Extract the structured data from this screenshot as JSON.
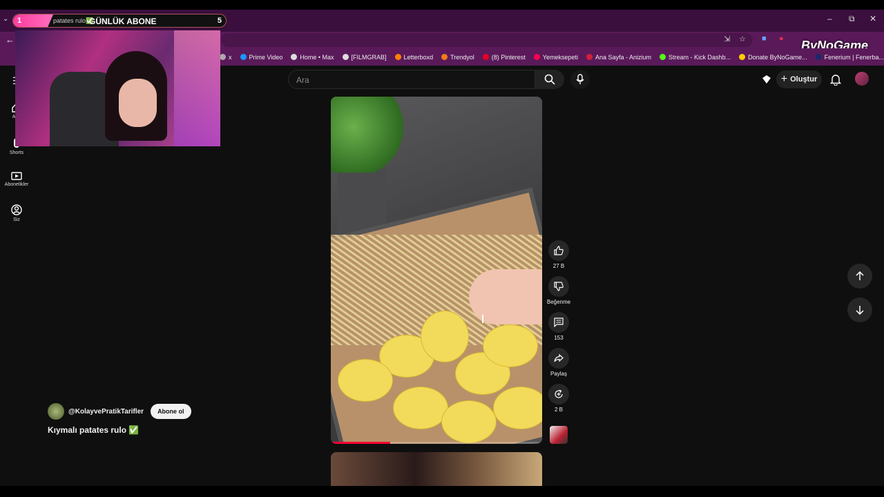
{
  "stream_overlay": {
    "left_number": "1",
    "small_text": "patates rulo✅",
    "title": "GÜNLÜK ABONE",
    "right_number": "5"
  },
  "window_controls": {
    "minimize": "–",
    "restore": "⧉",
    "close": "✕"
  },
  "bookmarks": [
    {
      "label": "x",
      "color": "#aaaaaa"
    },
    {
      "label": "Prime Video",
      "color": "#1a98ff"
    },
    {
      "label": "Home • Max",
      "color": "#dddddd"
    },
    {
      "label": "[FILMGRAB]",
      "color": "#dddddd"
    },
    {
      "label": "Letterboxd",
      "color": "#ff8000"
    },
    {
      "label": "Trendyol",
      "color": "#f27a1a"
    },
    {
      "label": "(8) Pinterest",
      "color": "#e60023"
    },
    {
      "label": "Yemeksepeti",
      "color": "#fa0050"
    },
    {
      "label": "Ana Sayfa - Anizium",
      "color": "#d0203a"
    },
    {
      "label": "Stream - Kick Dashb...",
      "color": "#53fc18"
    },
    {
      "label": "Donate ByNoGame...",
      "color": "#ffcc00"
    },
    {
      "label": "Fenerium | Fenerba...",
      "color": "#1a2a6a"
    }
  ],
  "bynogame_logo": "ByNoGame",
  "youtube": {
    "search_placeholder": "Ara",
    "create_label": "Oluştur",
    "sidebar": [
      {
        "label": "Ana",
        "icon": "home-icon"
      },
      {
        "label": "Shorts",
        "icon": "shorts-icon"
      },
      {
        "label": "Abonelikler",
        "icon": "subscriptions-icon"
      },
      {
        "label": "Siz",
        "icon": "you-icon"
      }
    ],
    "actions": {
      "like_count": "27 B",
      "dislike_label": "Beğenme",
      "comment_count": "153",
      "share_label": "Paylaş",
      "remix_count": "2 B"
    },
    "channel_name": "@KolayvePratikTarifler",
    "subscribe_label": "Abone ol",
    "video_title": "Kıymalı patates rulo ✅",
    "video_progress": 0.28
  },
  "colors": {
    "browser_tab_bg": "#3a0f3d",
    "browser_toolbar_bg": "#5a1a5a",
    "youtube_bg": "#0f0f0f",
    "progress_red": "#ff0033"
  }
}
